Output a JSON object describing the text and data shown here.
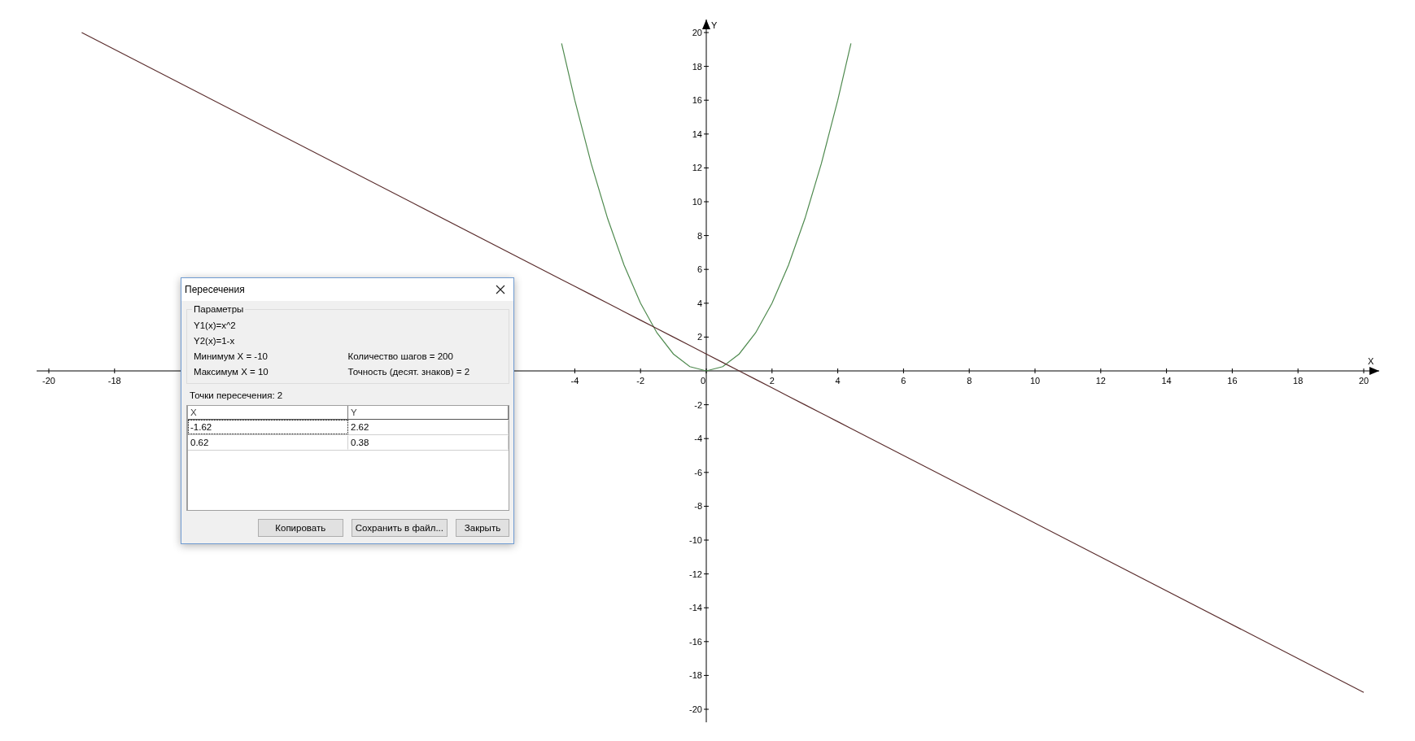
{
  "chart_data": {
    "type": "line",
    "xlabel": "X",
    "ylabel": "Y",
    "xlim": [
      -20.37,
      20.47
    ],
    "ylim": [
      -20.77,
      20.77
    ],
    "xticks": [
      -20,
      -18,
      -4,
      -2,
      0,
      2,
      4,
      6,
      8,
      10,
      12,
      14,
      16,
      18,
      20
    ],
    "yticks": [
      -20,
      -18,
      -16,
      -14,
      -12,
      -10,
      -8,
      -6,
      -4,
      -2,
      2,
      4,
      6,
      8,
      10,
      12,
      14,
      16,
      18,
      20
    ],
    "x": [
      -19,
      -4.4,
      -4,
      -3.5,
      -3,
      -2.5,
      -2,
      -1.5,
      -1,
      -0.5,
      0,
      0.5,
      1,
      1.5,
      2,
      2.5,
      3,
      3.5,
      4,
      4.4,
      20
    ],
    "series": [
      {
        "color": "#4f8a4f",
        "values": [
          null,
          19.36,
          16,
          12.25,
          9,
          6.25,
          4,
          2.25,
          1,
          0.25,
          0,
          0.25,
          1,
          2.25,
          4,
          6.25,
          9,
          12.25,
          16,
          19.36,
          null
        ]
      },
      {
        "color": "#5a2d2d",
        "values": [
          20,
          5.4,
          5,
          4.5,
          4,
          3.5,
          3,
          2.5,
          2,
          1.5,
          1,
          0.5,
          0,
          -0.5,
          -1,
          -1.5,
          -2,
          -2.5,
          -3,
          -3.4,
          -19
        ]
      }
    ]
  },
  "dialog": {
    "title": "Пересечения",
    "group_title": "Параметры",
    "params": [
      "Y1(x)=x^2",
      "Y2(x)=1-x"
    ],
    "params_left": [
      "Минимум X = -10",
      "Максимум X = 10"
    ],
    "params_right": [
      "Количество шагов = 200",
      "Точность (десят. знаков) = 2"
    ],
    "count_label": "Точки пересечения: 2",
    "table": {
      "columns": [
        "X",
        "Y"
      ],
      "rows": [
        {
          "cells": [
            "-1.62",
            "2.62"
          ],
          "selected": true
        },
        {
          "cells": [
            "0.62",
            "0.38"
          ],
          "selected": false
        }
      ]
    },
    "buttons": [
      "Копировать",
      "Сохранить в файл...",
      "Закрыть"
    ]
  }
}
